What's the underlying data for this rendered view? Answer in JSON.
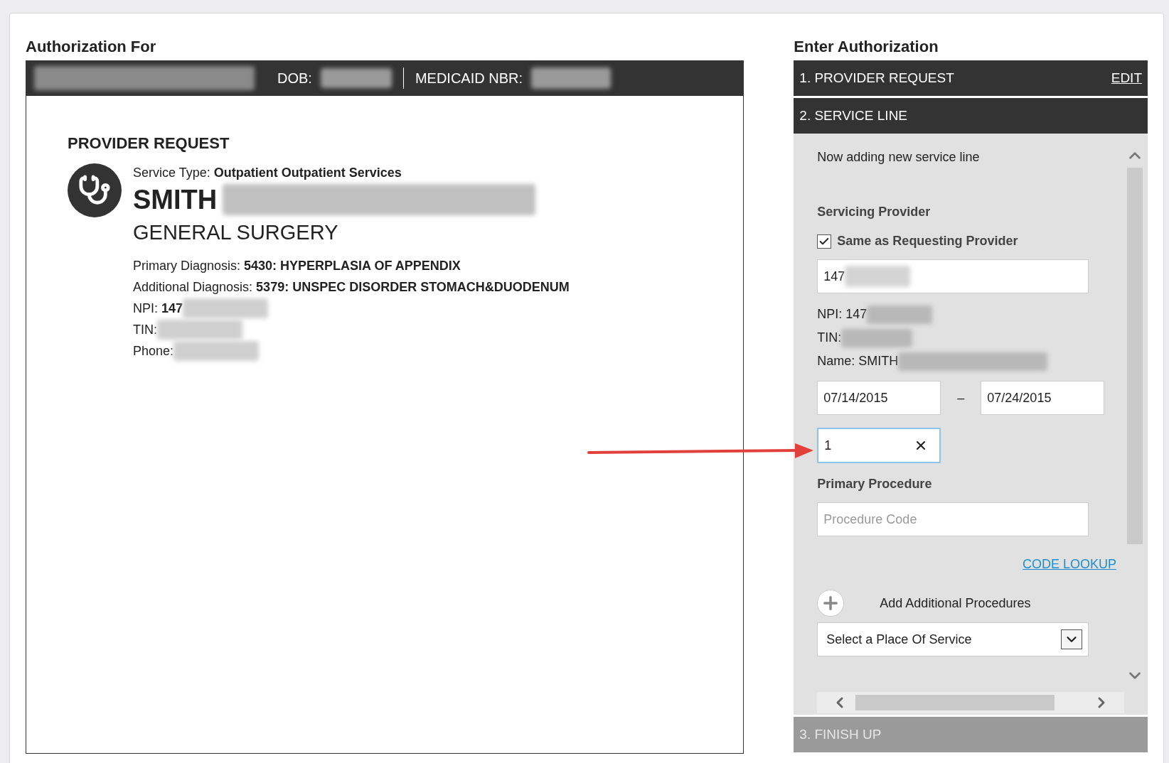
{
  "left": {
    "title": "Authorization For",
    "patient_bar": {
      "dob_label": "DOB:",
      "medicaid_label": "MEDICAID NBR:"
    },
    "section_title": "PROVIDER REQUEST",
    "service_type": "Service Type: **Outpatient Outpatient Services**",
    "provider_name": "SMITH",
    "specialty": "GENERAL SURGERY",
    "details": [
      {
        "text": "Primary Diagnosis: **5430: HYPERPLASIA OF APPENDIX**",
        "redacted": false
      },
      {
        "text": "Additional Diagnosis: **5379: UNSPEC DISORDER STOMACH&DUODENUM**",
        "redacted": false
      },
      {
        "text": "NPI: **147**",
        "redacted": true
      },
      {
        "text": "TIN:",
        "redacted": true
      },
      {
        "text": "Phone:",
        "redacted": true
      }
    ]
  },
  "right": {
    "title": "Enter Authorization",
    "steps": [
      {
        "label": "1. PROVIDER REQUEST",
        "action": "EDIT",
        "expanded": false,
        "disabled": false
      },
      {
        "label": "2. SERVICE LINE",
        "expanded": true,
        "disabled": false
      },
      {
        "label": "3. FINISH UP",
        "expanded": false,
        "disabled": true
      }
    ],
    "service_line": {
      "status": "Now adding new service line",
      "servicing_provider_label": "Servicing Provider",
      "same_as_requesting": {
        "label": "Same as Requesting Provider",
        "checked": true
      },
      "provider_field": {
        "value": "147"
      },
      "info": [
        {
          "text": "NPI: 147"
        },
        {
          "text": "TIN:"
        },
        {
          "text": "Name: SMITH"
        }
      ],
      "dates": {
        "from": "07/14/2015",
        "separator": "–",
        "to": "07/24/2015"
      },
      "units_field": {
        "value": "1",
        "focused": true
      },
      "primary_procedure": {
        "label": "Primary Procedure",
        "placeholder": "Procedure Code"
      },
      "code_lookup": "CODE LOOKUP",
      "add_procedures": "Add Additional Procedures",
      "place_of_service": "Select a Place Of Service"
    }
  }
}
